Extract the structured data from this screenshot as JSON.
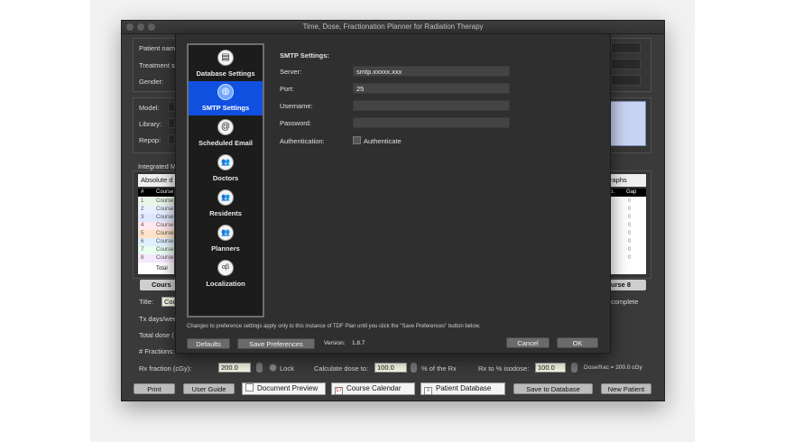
{
  "window": {
    "title": "Time, Dose, Fractionation Planner for Radiation Therapy"
  },
  "background_form": {
    "patient_name_label": "Patient nam",
    "treatment_label": "Treatment s",
    "gender_label": "Gender:",
    "model_label": "Model:",
    "library_label": "Library:",
    "repop_label": "Repop:",
    "integrated_label": "Integrated M",
    "absolute_label": "Absolute d",
    "graphs_label": "raphs",
    "table_headers": [
      "#",
      "Course"
    ],
    "table_rows": [
      {
        "num": "1",
        "name": "Course",
        "color": "#e8f6e8"
      },
      {
        "num": "2",
        "name": "Course",
        "color": "#e8f0ff"
      },
      {
        "num": "3",
        "name": "Course",
        "color": "#dfe8ff"
      },
      {
        "num": "4",
        "name": "Course",
        "color": "#ffe8ee"
      },
      {
        "num": "5",
        "name": "Course",
        "color": "#ffe3c8"
      },
      {
        "num": "6",
        "name": "Course",
        "color": "#dff0ff"
      },
      {
        "num": "7",
        "name": "Course",
        "color": "#e8fff0"
      },
      {
        "num": "8",
        "name": "Course",
        "color": "#f6e8ff"
      }
    ],
    "total_label": "Total",
    "right_headers": [
      "p.",
      "Gap"
    ],
    "gap_values": [
      "0",
      "0",
      "0",
      "0",
      "0",
      "0",
      "0",
      "0"
    ],
    "course_left_tab": "Cours",
    "course_right_tab": "urse 8",
    "title_label": "Title:",
    "title_value": "Cou",
    "complete_text": "complete",
    "tx_days_label": "Tx days/wee",
    "total_dose_label": "Total dose (",
    "fractions_label": "# Fractions:",
    "rx_fraction_label": "Rx fraction (cGy):",
    "rx_fraction_value": "200.0",
    "lock_label": "Lock",
    "calc_dose_label": "Calculate dose to:",
    "calc_dose_value": "100.0",
    "pct_rx_label": "% of the Rx",
    "rx_isodose_label": "Rx to % isodose:",
    "rx_isodose_value": "100.0",
    "dose_frac_text": "Dose/frac = 200.0 cGy"
  },
  "bottom_bar": {
    "print": "Print",
    "user_guide": "User Guide",
    "document_preview": "Document Preview",
    "course_calendar": "Course Calendar",
    "patient_database": "Patient Database",
    "save_to_database": "Save to Database",
    "new_patient": "New Patient"
  },
  "preferences": {
    "sidebar": [
      {
        "label": "Database Settings",
        "icon": "database-icon",
        "glyph": "▤"
      },
      {
        "label": "SMTP Settings",
        "icon": "globe-icon",
        "glyph": "◍"
      },
      {
        "label": "Scheduled Email",
        "icon": "at-sign-icon",
        "glyph": "@"
      },
      {
        "label": "Doctors",
        "icon": "people-icon",
        "glyph": "👥"
      },
      {
        "label": "Residents",
        "icon": "people-icon",
        "glyph": "👥"
      },
      {
        "label": "Planners",
        "icon": "people-icon",
        "glyph": "👥"
      },
      {
        "label": "Localization",
        "icon": "localization-icon",
        "glyph": "αβ"
      }
    ],
    "active_item": "SMTP Settings",
    "section_title": "SMTP Settings:",
    "server_label": "Server:",
    "server_value": "smtp.xxxxx.xxx",
    "port_label": "Port:",
    "port_value": "25",
    "username_label": "Username:",
    "username_value": "",
    "password_label": "Password:",
    "password_value": "",
    "authentication_label": "Authentication:",
    "authenticate_checkbox_label": "Authenticate",
    "note": "Changes to preference settings apply only to this instance of TDF Plan until you click the \"Save Preferences\" button below.",
    "defaults_button": "Defaults",
    "save_preferences_button": "Save Preferences",
    "version_label": "Version:",
    "version_value": "1.8.7",
    "cancel_button": "Cancel",
    "ok_button": "OK",
    "accent_color": "#1050e0"
  }
}
